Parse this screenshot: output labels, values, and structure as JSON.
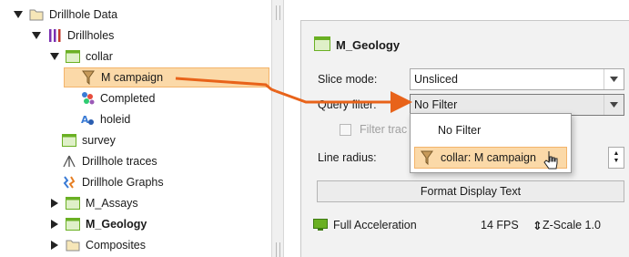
{
  "tree": {
    "items": [
      {
        "label": "Drillhole Data"
      },
      {
        "label": "Drillholes"
      },
      {
        "label": "collar"
      },
      {
        "label": "M campaign"
      },
      {
        "label": "Completed"
      },
      {
        "label": "holeid"
      },
      {
        "label": "survey"
      },
      {
        "label": "Drillhole traces"
      },
      {
        "label": "Drillhole Graphs"
      },
      {
        "label": "M_Assays"
      },
      {
        "label": "M_Geology"
      },
      {
        "label": "Composites"
      }
    ]
  },
  "properties": {
    "title": "M_Geology",
    "slice_mode": {
      "label": "Slice mode:",
      "value": "Unsliced"
    },
    "query_filter": {
      "label": "Query filter:",
      "value": "No Filter",
      "options": [
        "No Filter",
        "collar: M campaign"
      ]
    },
    "filter_traces": {
      "label": "Filter trac"
    },
    "line_radius": {
      "label": "Line radius:"
    },
    "format_button": "Format Display Text"
  },
  "status": {
    "acceleration": "Full Acceleration",
    "fps": "14 FPS",
    "zscale": "Z-Scale 1.0"
  },
  "colors": {
    "selection": "#fbd9a8",
    "arrow": "#e8631a",
    "table_green": "#6ab023",
    "folder": "#e9c46a"
  }
}
